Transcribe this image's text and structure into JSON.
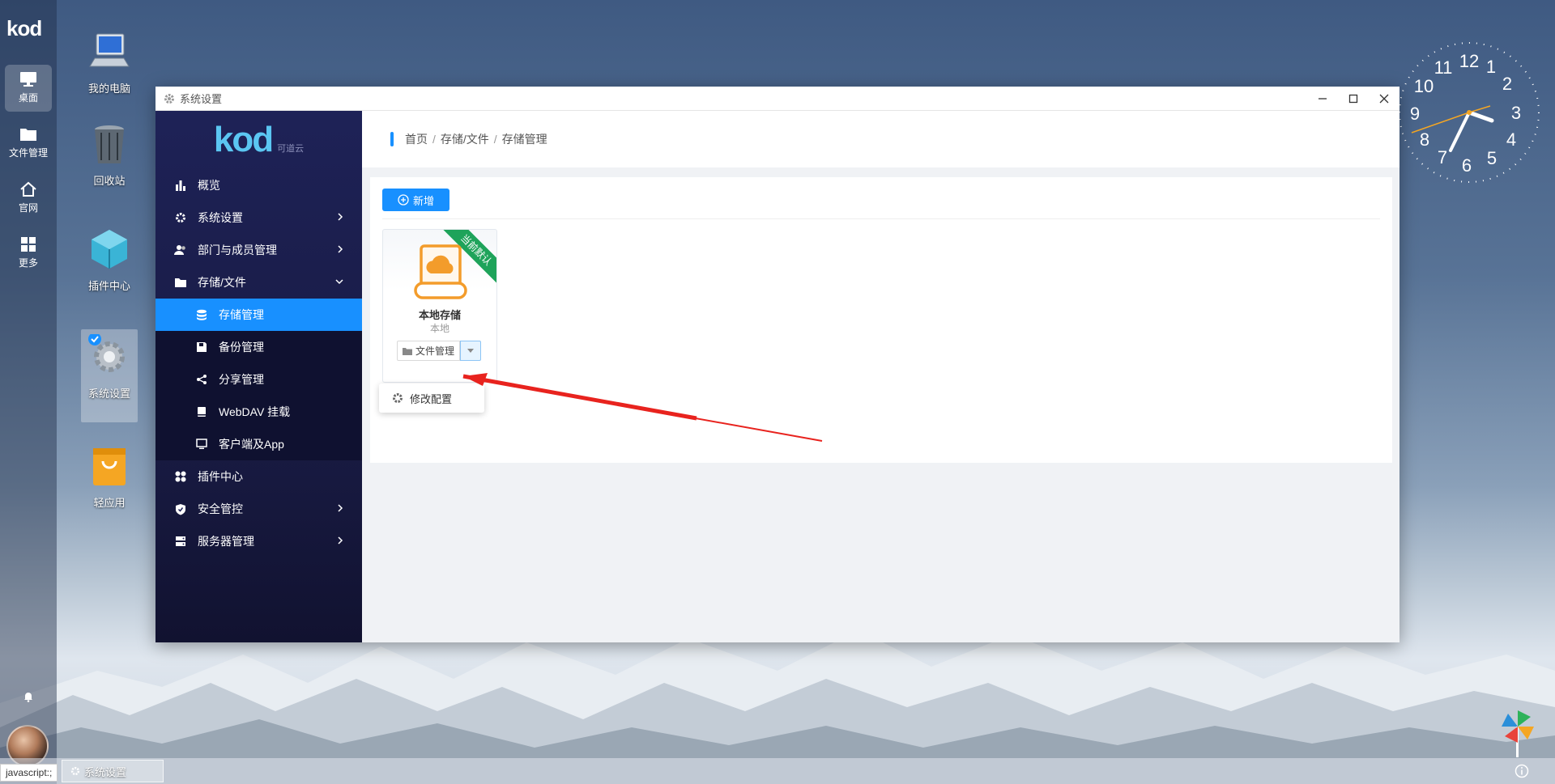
{
  "dock": {
    "logo": "kod",
    "items": [
      {
        "label": "桌面",
        "icon": "monitor-icon"
      },
      {
        "label": "文件管理",
        "icon": "folder-icon"
      },
      {
        "label": "官网",
        "icon": "home-icon"
      },
      {
        "label": "更多",
        "icon": "grid-icon"
      }
    ]
  },
  "desktop": {
    "icons": [
      {
        "label": "我的电脑",
        "icon": "computer-icon"
      },
      {
        "label": "回收站",
        "icon": "recycle-bin-icon"
      },
      {
        "label": "插件中心",
        "icon": "plugin-cube-icon"
      },
      {
        "label": "系统设置",
        "icon": "settings-gear-icon"
      },
      {
        "label": "轻应用",
        "icon": "shopping-bag-icon"
      }
    ]
  },
  "window": {
    "title": "系统设置",
    "sidebar": {
      "logo": "kod",
      "logo_sub": "可道云",
      "menu": [
        {
          "label": "概览",
          "icon": "bar-chart-icon"
        },
        {
          "label": "系统设置",
          "icon": "gear-icon"
        },
        {
          "label": "部门与成员管理",
          "icon": "users-icon"
        },
        {
          "label": "存储/文件",
          "icon": "folder-icon"
        },
        {
          "label": "存储管理",
          "icon": "database-icon"
        },
        {
          "label": "备份管理",
          "icon": "save-icon"
        },
        {
          "label": "分享管理",
          "icon": "share-icon"
        },
        {
          "label": "WebDAV 挂载",
          "icon": "book-icon"
        },
        {
          "label": "客户端及App",
          "icon": "monitor-icon"
        },
        {
          "label": "插件中心",
          "icon": "apps-icon"
        },
        {
          "label": "安全管控",
          "icon": "shield-icon"
        },
        {
          "label": "服务器管理",
          "icon": "server-icon"
        }
      ]
    },
    "breadcrumb": [
      "首页",
      "存储/文件",
      "存储管理"
    ],
    "add_button": "新增",
    "storage_card": {
      "ribbon": "当前默认",
      "name": "本地存储",
      "type": "本地",
      "file_button": "文件管理"
    },
    "dropdown_item": "修改配置"
  },
  "clock": {
    "numbers": [
      "12",
      "1",
      "2",
      "3",
      "4",
      "5",
      "6",
      "7",
      "8",
      "9",
      "10",
      "11"
    ]
  },
  "taskbar": {
    "status": "javascript:;",
    "task_label": "系统设置"
  }
}
